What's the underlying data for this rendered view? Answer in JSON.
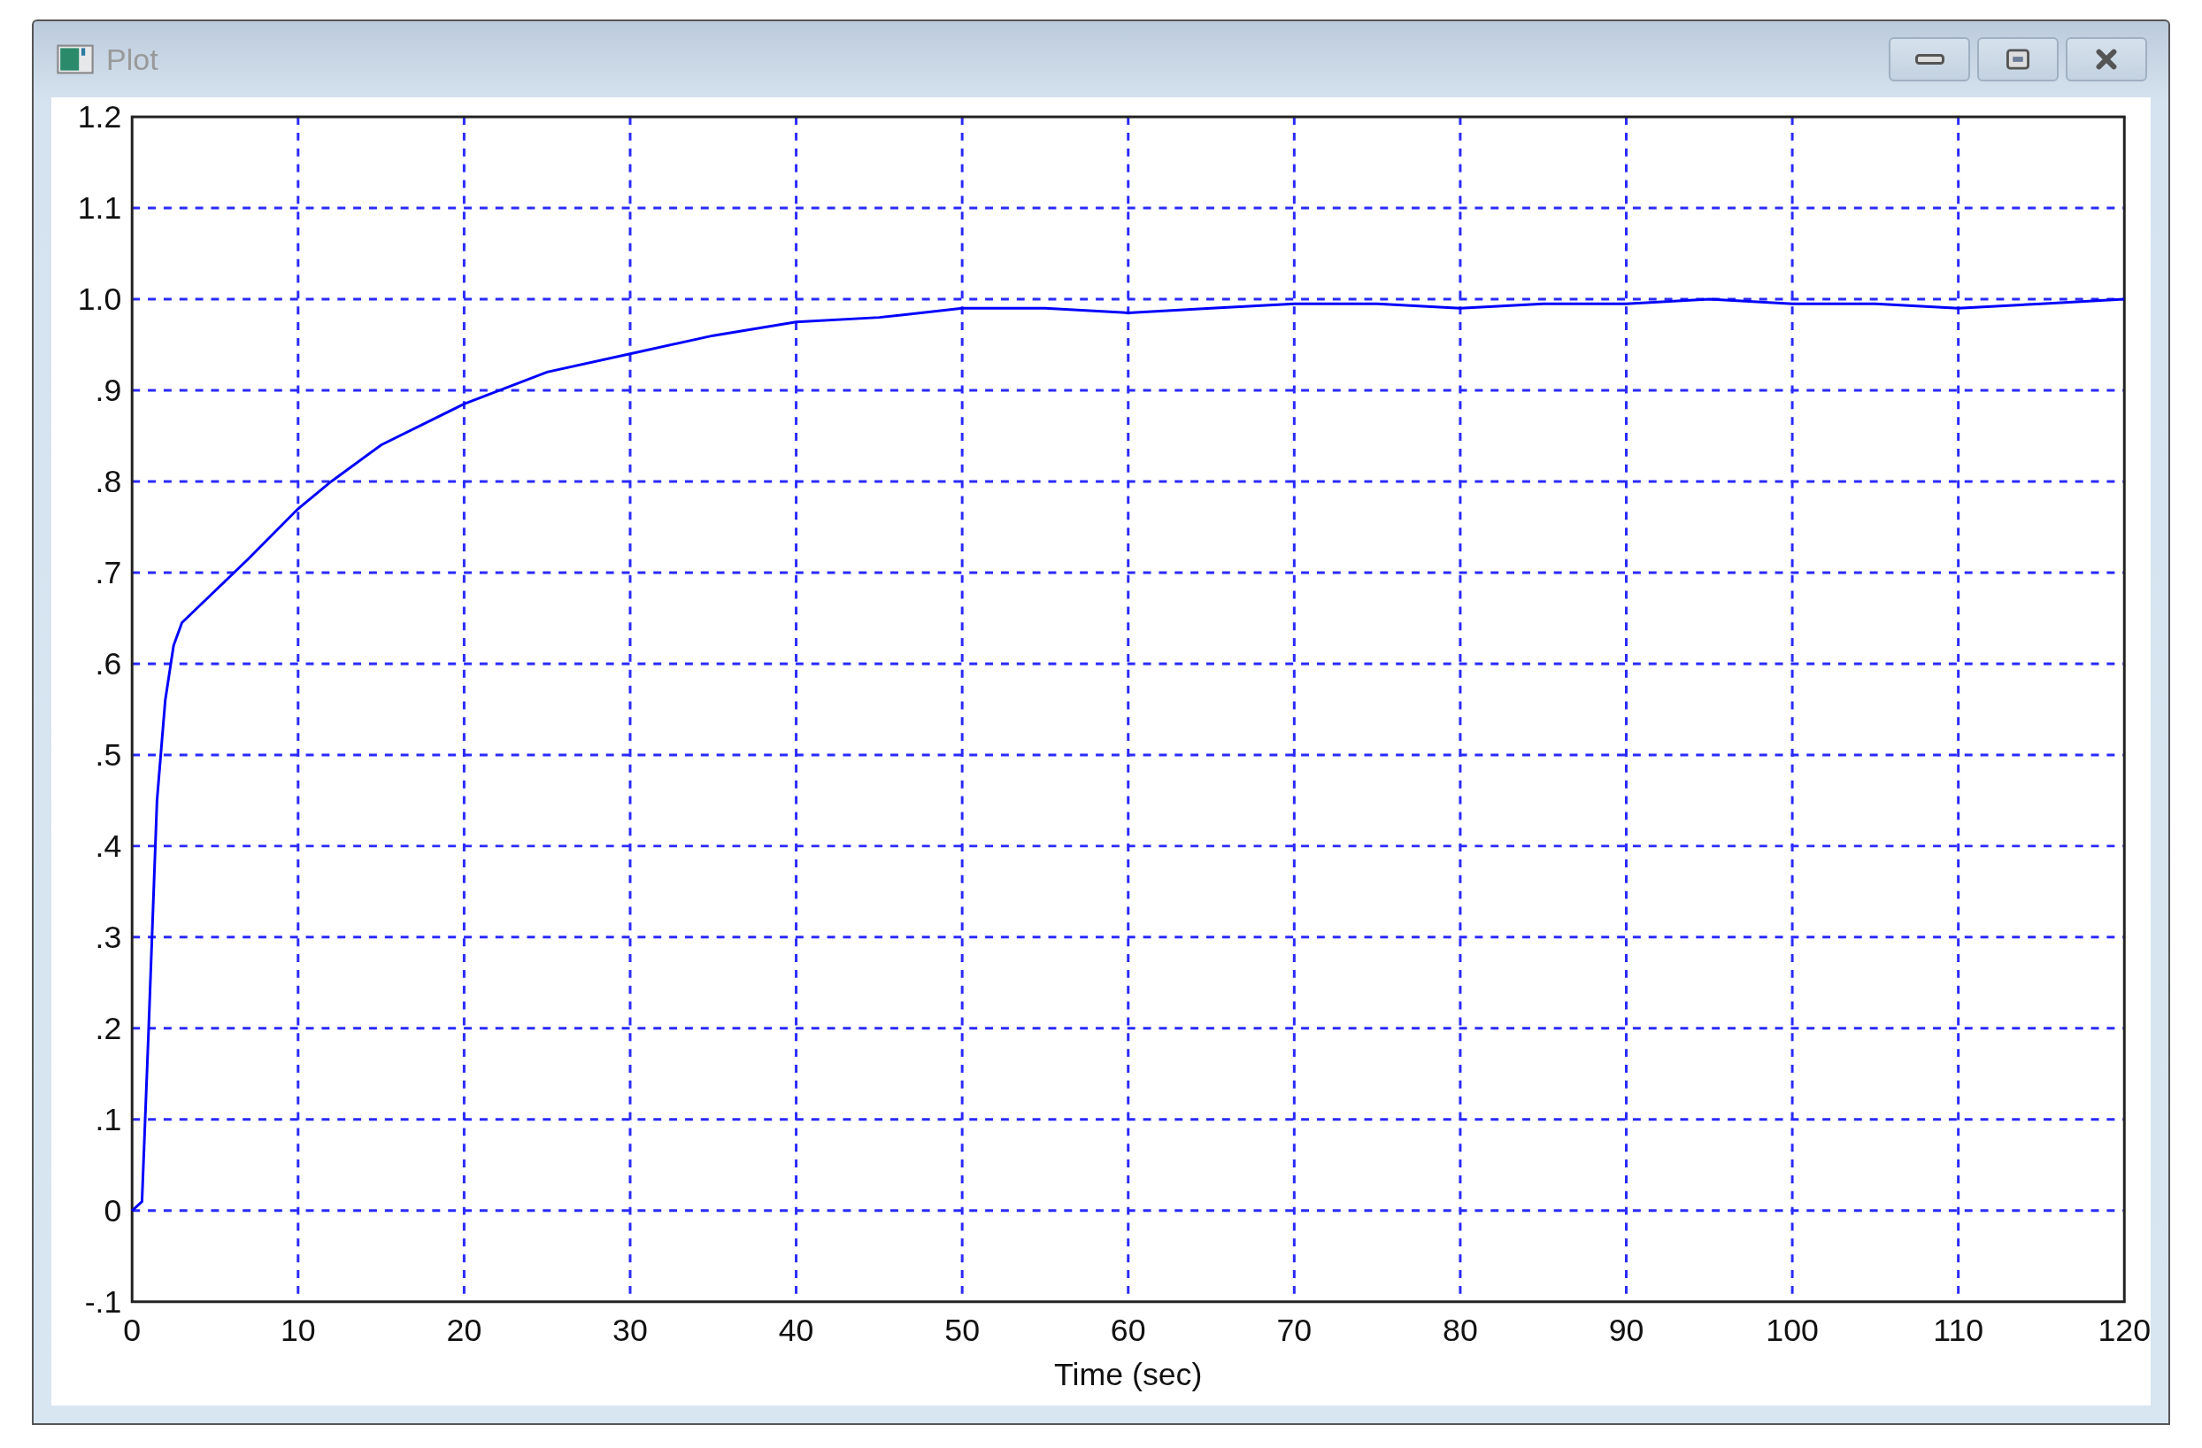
{
  "window": {
    "title": "Plot"
  },
  "title_buttons": [
    {
      "kind": "minimize"
    },
    {
      "kind": "maximize"
    },
    {
      "kind": "close"
    }
  ],
  "chart_data": {
    "type": "line",
    "grid": true,
    "xlabel": "Time (sec)",
    "xlim": [
      0,
      120
    ],
    "ylim": [
      -0.1,
      1.2
    ],
    "xticks": [
      0,
      10,
      20,
      30,
      40,
      50,
      60,
      70,
      80,
      90,
      100,
      110,
      120
    ],
    "yticks": [
      {
        "value": 1.2,
        "label": "1.2"
      },
      {
        "value": 1.1,
        "label": "1.1"
      },
      {
        "value": 1.0,
        "label": "1.0"
      },
      {
        "value": 0.9,
        "label": ".9"
      },
      {
        "value": 0.8,
        "label": ".8"
      },
      {
        "value": 0.7,
        "label": ".7"
      },
      {
        "value": 0.6,
        "label": ".6"
      },
      {
        "value": 0.5,
        "label": ".5"
      },
      {
        "value": 0.4,
        "label": ".4"
      },
      {
        "value": 0.3,
        "label": ".3"
      },
      {
        "value": 0.2,
        "label": ".2"
      },
      {
        "value": 0.1,
        "label": ".1"
      },
      {
        "value": 0,
        "label": "0"
      },
      {
        "value": -0.1,
        "label": "-.1"
      }
    ],
    "x": [
      0,
      0.6,
      1,
      1.5,
      2,
      2.5,
      3,
      5,
      7,
      10,
      12,
      15,
      20,
      25,
      30,
      35,
      40,
      45,
      50,
      55,
      60,
      65,
      70,
      75,
      80,
      85,
      90,
      95,
      100,
      105,
      110,
      115,
      120
    ],
    "series": [
      {
        "color": "#0000ff",
        "values": [
          0,
          0.01,
          0.2,
          0.45,
          0.56,
          0.62,
          0.645,
          0.68,
          0.715,
          0.77,
          0.8,
          0.84,
          0.885,
          0.92,
          0.94,
          0.96,
          0.975,
          0.98,
          0.99,
          0.99,
          0.985,
          0.99,
          0.995,
          0.995,
          0.99,
          0.995,
          0.995,
          1.0,
          0.995,
          0.995,
          0.99,
          0.995,
          1.0
        ]
      }
    ]
  }
}
